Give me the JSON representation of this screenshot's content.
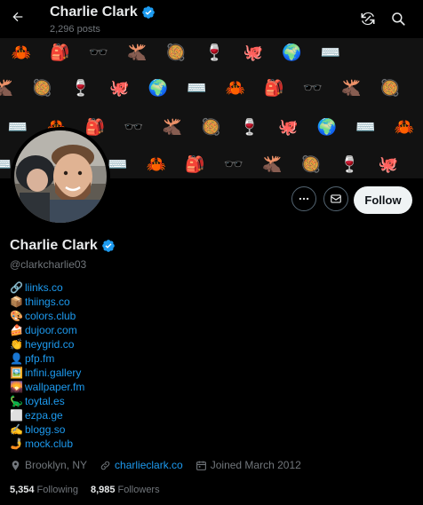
{
  "header": {
    "title": "Charlie Clark",
    "post_count": "2,296 posts"
  },
  "icons": {
    "back": "arrow-left-icon",
    "refresh": "refresh-icon",
    "search": "search-icon",
    "verified": "verified-badge-icon",
    "more": "more-icon",
    "message": "mail-icon",
    "location": "location-pin-icon",
    "link": "link-icon",
    "calendar": "calendar-icon"
  },
  "colors": {
    "accent": "#1d9bf0",
    "background": "#000000",
    "muted": "#71767b",
    "text": "#e7e9ea"
  },
  "banner": {
    "rows": [
      [
        "🦀",
        "🎒",
        "🕶️",
        "🫎",
        "🥘",
        "🍷",
        "🐙",
        "🌍",
        "⌨️",
        "",
        ""
      ],
      [
        "🫎",
        "🥘",
        "🍷",
        "🐙",
        "🌍",
        "⌨️",
        "🦀",
        "🎒",
        "🕶️",
        "🫎",
        "🥘"
      ],
      [
        "⌨️",
        "🦀",
        "🎒",
        "🕶️",
        "🫎",
        "🥘",
        "🍷",
        "🐙",
        "🌍",
        "⌨️",
        "🦀"
      ],
      [
        "⌨️",
        "🐙",
        "🌍",
        "⌨️",
        "🦀",
        "🎒",
        "🕶️",
        "🫎",
        "🥘",
        "🍷",
        "🐙"
      ]
    ]
  },
  "actions": {
    "follow_label": "Follow"
  },
  "profile": {
    "name": "Charlie Clark",
    "handle": "@clarkcharlie03",
    "links": [
      {
        "emoji": "🔗",
        "text": "liinks.co"
      },
      {
        "emoji": "📦",
        "text": "thiings.co"
      },
      {
        "emoji": "🎨",
        "text": "colors.club"
      },
      {
        "emoji": "🍰",
        "text": "dujoor.com"
      },
      {
        "emoji": "👏",
        "text": "heygrid.co"
      },
      {
        "emoji": "👤",
        "text": "pfp.fm"
      },
      {
        "emoji": "🖼️",
        "text": "infini.gallery"
      },
      {
        "emoji": "🌄",
        "text": "wallpaper.fm"
      },
      {
        "emoji": "🦕",
        "text": "toytal.es"
      },
      {
        "emoji": "⬜",
        "text": "ezpa.ge"
      },
      {
        "emoji": "✍️",
        "text": "blogg.so"
      },
      {
        "emoji": "🤳",
        "text": "mock.club"
      }
    ],
    "location": "Brooklyn, NY",
    "website": "charlieclark.co",
    "joined": "Joined March 2012",
    "following_count": "5,354",
    "following_label": "Following",
    "followers_count": "8,985",
    "followers_label": "Followers"
  }
}
